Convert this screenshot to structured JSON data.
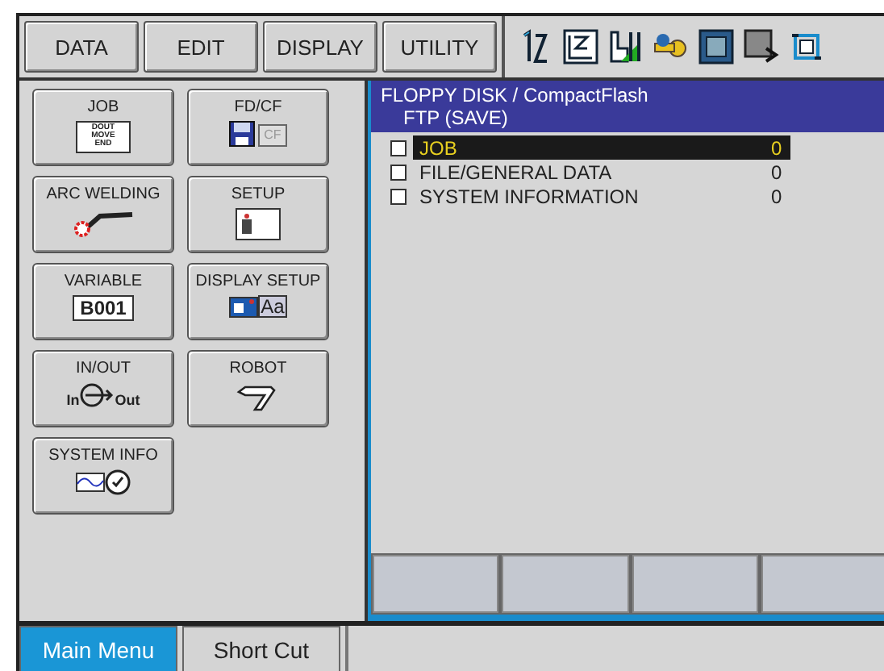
{
  "menu_bar": [
    {
      "label": "DATA"
    },
    {
      "label": "EDIT"
    },
    {
      "label": "DISPLAY"
    },
    {
      "label": "UTILITY"
    }
  ],
  "main_menu": [
    {
      "label": "JOB",
      "kind": "job",
      "icon_text": [
        "DOUT",
        "MOVE",
        "END"
      ]
    },
    {
      "label": "FD/CF",
      "kind": "fdcf",
      "icon_text": [
        "CF"
      ]
    },
    {
      "label": "ARC WELDING",
      "kind": "arc"
    },
    {
      "label": "SETUP",
      "kind": "setup"
    },
    {
      "label": "VARIABLE",
      "kind": "variable",
      "icon_text": [
        "B001"
      ]
    },
    {
      "label": "DISPLAY SETUP",
      "kind": "display",
      "icon_text": [
        "Aa"
      ]
    },
    {
      "label": "IN/OUT",
      "kind": "io",
      "icon_text": [
        "In",
        "Out"
      ]
    },
    {
      "label": "ROBOT",
      "kind": "robot"
    },
    {
      "label": "SYSTEM INFO",
      "kind": "sysinfo"
    }
  ],
  "panel": {
    "title": "FLOPPY DISK / CompactFlash",
    "subtitle": "FTP (SAVE)",
    "items": [
      {
        "label": "JOB",
        "value": "0",
        "checked": false,
        "selected": true
      },
      {
        "label": "FILE/GENERAL DATA",
        "value": "0",
        "checked": false,
        "selected": false
      },
      {
        "label": "SYSTEM INFORMATION",
        "value": "0",
        "checked": false,
        "selected": false
      }
    ]
  },
  "bottom_tabs": [
    {
      "label": "Main Menu",
      "selected": true
    },
    {
      "label": "Short Cut",
      "selected": false
    }
  ]
}
